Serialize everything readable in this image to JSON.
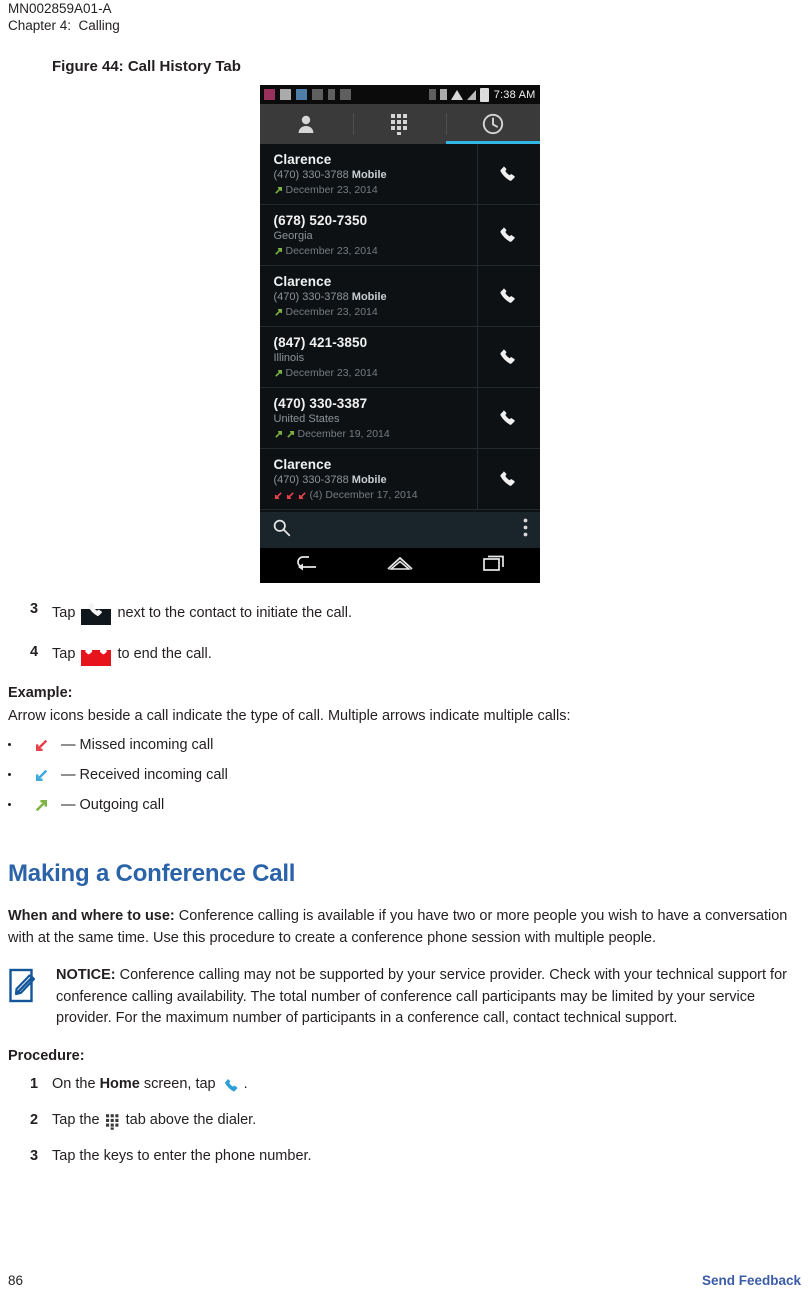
{
  "header": {
    "doc_id": "MN002859A01-A",
    "chapter": "Chapter 4:  Calling"
  },
  "figure": {
    "caption": "Figure 44: Call History Tab"
  },
  "phone": {
    "status_bar": {
      "time": "7:38 AM",
      "icons": [
        "app-grid-icon",
        "screenshot-icon",
        "camera-icon",
        "sd-card-icon",
        "question-icon",
        "sim-icon",
        "zero-icon",
        "vibrate-icon",
        "wifi-icon",
        "signal-icon",
        "battery-icon"
      ]
    },
    "tabs": [
      {
        "name": "contacts-tab",
        "icon": "person-icon",
        "selected": false
      },
      {
        "name": "dialpad-tab",
        "icon": "dialpad-icon",
        "selected": false
      },
      {
        "name": "history-tab",
        "icon": "clock-icon",
        "selected": true
      }
    ],
    "accent_color": "#33b5e5",
    "call_log": [
      {
        "title": "Clarence",
        "subtitle": "(470) 330-3788 ",
        "subtitle_bold": "Mobile",
        "arrows": [
          "outgoing"
        ],
        "date": "December 23, 2014",
        "count": ""
      },
      {
        "title": "(678) 520-7350",
        "subtitle": "Georgia",
        "subtitle_bold": "",
        "arrows": [
          "outgoing"
        ],
        "date": "December 23, 2014",
        "count": ""
      },
      {
        "title": "Clarence",
        "subtitle": "(470) 330-3788 ",
        "subtitle_bold": "Mobile",
        "arrows": [
          "outgoing"
        ],
        "date": "December 23, 2014",
        "count": ""
      },
      {
        "title": "(847) 421-3850",
        "subtitle": "Illinois",
        "subtitle_bold": "",
        "arrows": [
          "outgoing"
        ],
        "date": "December 23, 2014",
        "count": ""
      },
      {
        "title": "(470) 330-3387",
        "subtitle": "United States",
        "subtitle_bold": "",
        "arrows": [
          "outgoing",
          "outgoing"
        ],
        "date": "December 19, 2014",
        "count": ""
      },
      {
        "title": "Clarence",
        "subtitle": "(470) 330-3788 ",
        "subtitle_bold": "Mobile",
        "arrows": [
          "missed",
          "missed",
          "missed"
        ],
        "date": "December 17, 2014",
        "count": "(4)"
      }
    ],
    "action_bar": {
      "search_icon": "search-icon",
      "overflow_icon": "overflow-menu-icon"
    },
    "nav_bar": {
      "back_icon": "back-icon",
      "home_icon": "home-icon",
      "recents_icon": "recents-icon"
    }
  },
  "steps_top": [
    {
      "num": "3",
      "pre": "Tap ",
      "icon": "phone-handset-icon",
      "post": " next to the contact to initiate the call."
    },
    {
      "num": "4",
      "pre": "Tap ",
      "icon": "end-call-icon",
      "post": " to end the call."
    }
  ],
  "example": {
    "label": "Example:",
    "intro": "Arrow icons beside a call indicate the type of call. Multiple arrows indicate multiple calls:",
    "items": [
      {
        "icon": "missed-call-arrow-icon",
        "color": "#e8414b",
        "text": "— Missed incoming call"
      },
      {
        "icon": "received-call-arrow-icon",
        "color": "#3fa9dd",
        "text": "— Received incoming call"
      },
      {
        "icon": "outgoing-call-arrow-icon",
        "color": "#7cb342",
        "text": "— Outgoing call"
      }
    ]
  },
  "section": {
    "heading": "Making a Conference Call",
    "heading_color": "#2b63a8",
    "when_label": "When and where to use:",
    "when_text": " Conference calling is available if you have two or more people you wish to have a conversation with at the same time. Use this procedure to create a conference phone session with multiple people."
  },
  "notice": {
    "icon": "notice-pencil-icon",
    "label": "NOTICE:",
    "text": " Conference calling may not be supported by your service provider. Check with your technical support for conference calling availability. The total number of conference call participants may be limited by your service provider. For the maximum number of participants in a conference call, contact technical support."
  },
  "procedure": {
    "label": "Procedure:",
    "steps": [
      {
        "num": "1",
        "pre": "On the ",
        "bold": "Home",
        "mid": " screen, tap ",
        "icon": "blue-phone-icon",
        "post": "."
      },
      {
        "num": "2",
        "pre": "Tap the ",
        "bold": "",
        "mid": "",
        "icon": "dialpad-icon",
        "post": " tab above the dialer."
      },
      {
        "num": "3",
        "pre": "Tap the keys to enter the phone number.",
        "bold": "",
        "mid": "",
        "icon": "",
        "post": ""
      }
    ]
  },
  "footer": {
    "page_number": "86",
    "feedback_label": "Send Feedback",
    "feedback_color": "#3b5ca8"
  }
}
